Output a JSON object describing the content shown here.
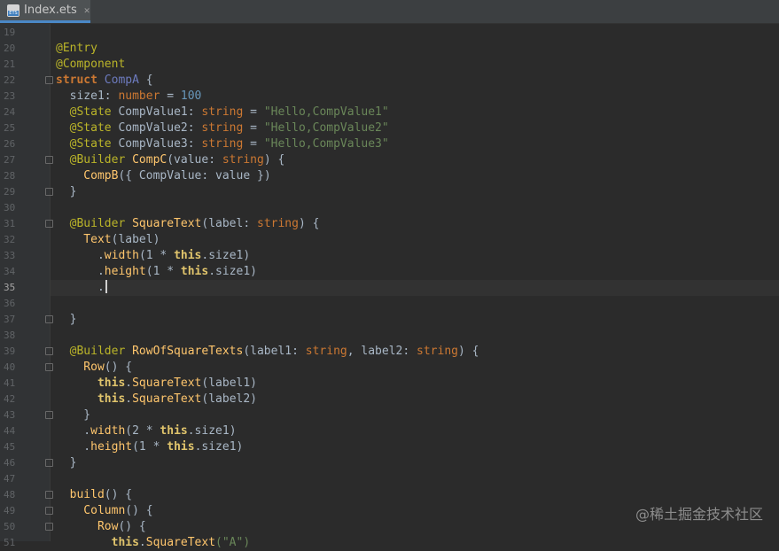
{
  "tab": {
    "label": "Index.ets",
    "icon": "ets-file-icon",
    "icon_badge": "ETS"
  },
  "colors": {
    "keyword": "#cc7832",
    "annotation": "#bbb529",
    "identifier": "#a9b7c6",
    "type_name": "#6d7bbf",
    "string": "#6a8759",
    "number": "#6897bb",
    "function": "#ffc66d",
    "property": "#9876aa",
    "this_kw": "#e0c46c"
  },
  "lines": [
    {
      "num": "19",
      "tokens": []
    },
    {
      "num": "20",
      "tokens": [
        {
          "t": "@Entry",
          "c": "annotation"
        }
      ]
    },
    {
      "num": "21",
      "tokens": [
        {
          "t": "@Component",
          "c": "annotation"
        }
      ]
    },
    {
      "num": "22",
      "fold": true,
      "tokens": [
        {
          "t": "struct ",
          "c": "keyword_bold"
        },
        {
          "t": "CompA",
          "c": "type_name"
        },
        {
          "t": " {",
          "c": "identifier"
        }
      ]
    },
    {
      "num": "23",
      "tokens": [
        {
          "t": "  size1: ",
          "c": "identifier"
        },
        {
          "t": "number",
          "c": "keyword"
        },
        {
          "t": " = ",
          "c": "identifier"
        },
        {
          "t": "100",
          "c": "number"
        }
      ]
    },
    {
      "num": "24",
      "tokens": [
        {
          "t": "  @State ",
          "c": "annotation"
        },
        {
          "t": "CompValue1: ",
          "c": "identifier"
        },
        {
          "t": "string",
          "c": "keyword"
        },
        {
          "t": " = ",
          "c": "identifier"
        },
        {
          "t": "\"Hello,CompValue1\"",
          "c": "string"
        }
      ]
    },
    {
      "num": "25",
      "tokens": [
        {
          "t": "  @State ",
          "c": "annotation"
        },
        {
          "t": "CompValue2: ",
          "c": "identifier"
        },
        {
          "t": "string",
          "c": "keyword"
        },
        {
          "t": " = ",
          "c": "identifier"
        },
        {
          "t": "\"Hello,CompValue2\"",
          "c": "string"
        }
      ]
    },
    {
      "num": "26",
      "tokens": [
        {
          "t": "  @State ",
          "c": "annotation"
        },
        {
          "t": "CompValue3: ",
          "c": "identifier"
        },
        {
          "t": "string",
          "c": "keyword"
        },
        {
          "t": " = ",
          "c": "identifier"
        },
        {
          "t": "\"Hello,CompValue3\"",
          "c": "string"
        }
      ]
    },
    {
      "num": "27",
      "fold": true,
      "tokens": [
        {
          "t": "  @Builder ",
          "c": "annotation"
        },
        {
          "t": "CompC",
          "c": "function"
        },
        {
          "t": "(value: ",
          "c": "identifier"
        },
        {
          "t": "string",
          "c": "keyword"
        },
        {
          "t": ") {",
          "c": "identifier"
        }
      ]
    },
    {
      "num": "28",
      "tokens": [
        {
          "t": "    CompB",
          "c": "function"
        },
        {
          "t": "({ CompValue: value })",
          "c": "identifier"
        }
      ]
    },
    {
      "num": "29",
      "fold": true,
      "tokens": [
        {
          "t": "  }",
          "c": "identifier"
        }
      ]
    },
    {
      "num": "30",
      "tokens": []
    },
    {
      "num": "31",
      "fold": true,
      "tokens": [
        {
          "t": "  @Builder ",
          "c": "annotation"
        },
        {
          "t": "SquareText",
          "c": "function"
        },
        {
          "t": "(label: ",
          "c": "identifier"
        },
        {
          "t": "string",
          "c": "keyword"
        },
        {
          "t": ") {",
          "c": "identifier"
        }
      ]
    },
    {
      "num": "32",
      "tokens": [
        {
          "t": "    Text",
          "c": "function"
        },
        {
          "t": "(label)",
          "c": "identifier"
        }
      ]
    },
    {
      "num": "33",
      "tokens": [
        {
          "t": "      .",
          "c": "identifier"
        },
        {
          "t": "width",
          "c": "function"
        },
        {
          "t": "(1 * ",
          "c": "identifier"
        },
        {
          "t": "this",
          "c": "this_kw"
        },
        {
          "t": ".size1)",
          "c": "identifier"
        }
      ]
    },
    {
      "num": "34",
      "tokens": [
        {
          "t": "      .",
          "c": "identifier"
        },
        {
          "t": "height",
          "c": "function"
        },
        {
          "t": "(1 * ",
          "c": "identifier"
        },
        {
          "t": "this",
          "c": "this_kw"
        },
        {
          "t": ".size1)",
          "c": "identifier"
        }
      ]
    },
    {
      "num": "35",
      "current": true,
      "tokens": [
        {
          "t": "      .",
          "c": "identifier"
        }
      ]
    },
    {
      "num": "36",
      "tokens": []
    },
    {
      "num": "37",
      "fold": true,
      "tokens": [
        {
          "t": "  }",
          "c": "identifier"
        }
      ]
    },
    {
      "num": "38",
      "tokens": []
    },
    {
      "num": "39",
      "fold": true,
      "tokens": [
        {
          "t": "  @Builder ",
          "c": "annotation"
        },
        {
          "t": "RowOfSquareTexts",
          "c": "function"
        },
        {
          "t": "(label1: ",
          "c": "identifier"
        },
        {
          "t": "string",
          "c": "keyword"
        },
        {
          "t": ", label2: ",
          "c": "identifier"
        },
        {
          "t": "string",
          "c": "keyword"
        },
        {
          "t": ") {",
          "c": "identifier"
        }
      ]
    },
    {
      "num": "40",
      "fold": true,
      "tokens": [
        {
          "t": "    Row",
          "c": "function"
        },
        {
          "t": "() {",
          "c": "identifier"
        }
      ]
    },
    {
      "num": "41",
      "tokens": [
        {
          "t": "      this",
          "c": "this_kw"
        },
        {
          "t": ".",
          "c": "identifier"
        },
        {
          "t": "SquareText",
          "c": "function"
        },
        {
          "t": "(label1)",
          "c": "identifier"
        }
      ]
    },
    {
      "num": "42",
      "tokens": [
        {
          "t": "      this",
          "c": "this_kw"
        },
        {
          "t": ".",
          "c": "identifier"
        },
        {
          "t": "SquareText",
          "c": "function"
        },
        {
          "t": "(label2)",
          "c": "identifier"
        }
      ]
    },
    {
      "num": "43",
      "fold": true,
      "tokens": [
        {
          "t": "    }",
          "c": "identifier"
        }
      ]
    },
    {
      "num": "44",
      "tokens": [
        {
          "t": "    .",
          "c": "identifier"
        },
        {
          "t": "width",
          "c": "function"
        },
        {
          "t": "(2 * ",
          "c": "identifier"
        },
        {
          "t": "this",
          "c": "this_kw"
        },
        {
          "t": ".size1)",
          "c": "identifier"
        }
      ]
    },
    {
      "num": "45",
      "tokens": [
        {
          "t": "    .",
          "c": "identifier"
        },
        {
          "t": "height",
          "c": "function"
        },
        {
          "t": "(1 * ",
          "c": "identifier"
        },
        {
          "t": "this",
          "c": "this_kw"
        },
        {
          "t": ".size1)",
          "c": "identifier"
        }
      ]
    },
    {
      "num": "46",
      "fold": true,
      "tokens": [
        {
          "t": "  }",
          "c": "identifier"
        }
      ]
    },
    {
      "num": "47",
      "tokens": []
    },
    {
      "num": "48",
      "fold": true,
      "tokens": [
        {
          "t": "  build",
          "c": "function"
        },
        {
          "t": "() {",
          "c": "identifier"
        }
      ]
    },
    {
      "num": "49",
      "fold": true,
      "tokens": [
        {
          "t": "    Column",
          "c": "function"
        },
        {
          "t": "() {",
          "c": "identifier"
        }
      ]
    },
    {
      "num": "50",
      "fold": true,
      "tokens": [
        {
          "t": "      Row",
          "c": "function"
        },
        {
          "t": "() {",
          "c": "identifier"
        }
      ]
    },
    {
      "num": "51",
      "tokens": [
        {
          "t": "        this",
          "c": "this_kw"
        },
        {
          "t": ".",
          "c": "identifier"
        },
        {
          "t": "SquareText",
          "c": "function"
        },
        {
          "t": "(\"A\")",
          "c": "string"
        }
      ]
    }
  ],
  "watermark": "@稀土掘金技术社区"
}
